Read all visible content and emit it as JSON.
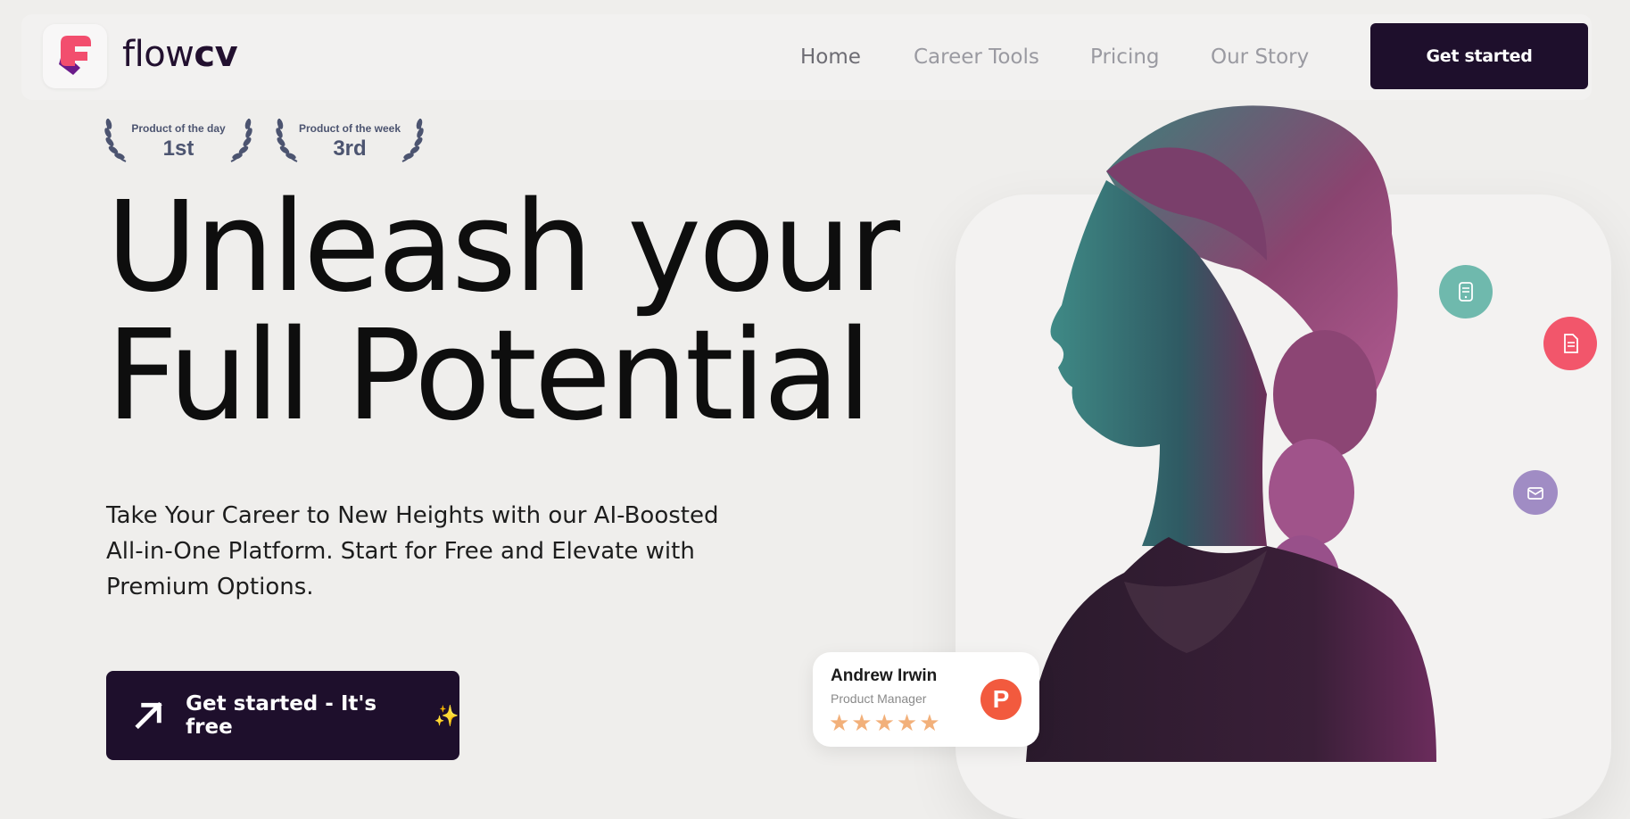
{
  "brand": {
    "name_light": "flow",
    "name_bold": "cv"
  },
  "nav": {
    "links": [
      {
        "label": "Home"
      },
      {
        "label": "Career Tools"
      },
      {
        "label": "Pricing"
      },
      {
        "label": "Our Story"
      }
    ],
    "cta": "Get started"
  },
  "awards": [
    {
      "title": "Product of the day",
      "rank": "1st"
    },
    {
      "title": "Product of the week",
      "rank": "3rd"
    }
  ],
  "hero": {
    "title_line1": "Unleash your",
    "title_line2": "Full Potential",
    "subtitle": "Take Your Career to New Heights with our AI-Boosted All-in-One Platform. Start for Free and Elevate with Premium Options.",
    "cta": "Get started - It's free",
    "cta_emoji": "✨"
  },
  "review": {
    "name": "Andrew Irwin",
    "role": "Product Manager",
    "stars": "★★★★★",
    "badge_letter": "P",
    "rating": 5
  },
  "colors": {
    "primary_dark": "#1e0f2c",
    "background": "#efeeec",
    "bubble_teal": "#6fb9ad",
    "bubble_pink": "#f2566b",
    "bubble_purple": "#a08cc4",
    "producthunt": "#f25a3e",
    "star": "#f2b07a"
  },
  "icons": {
    "logo": "flowcv-logo-icon",
    "cta_arrow": "arrow-up-right-icon",
    "bubbles": [
      "mobile-resume-icon",
      "document-icon",
      "envelope-icon"
    ]
  }
}
